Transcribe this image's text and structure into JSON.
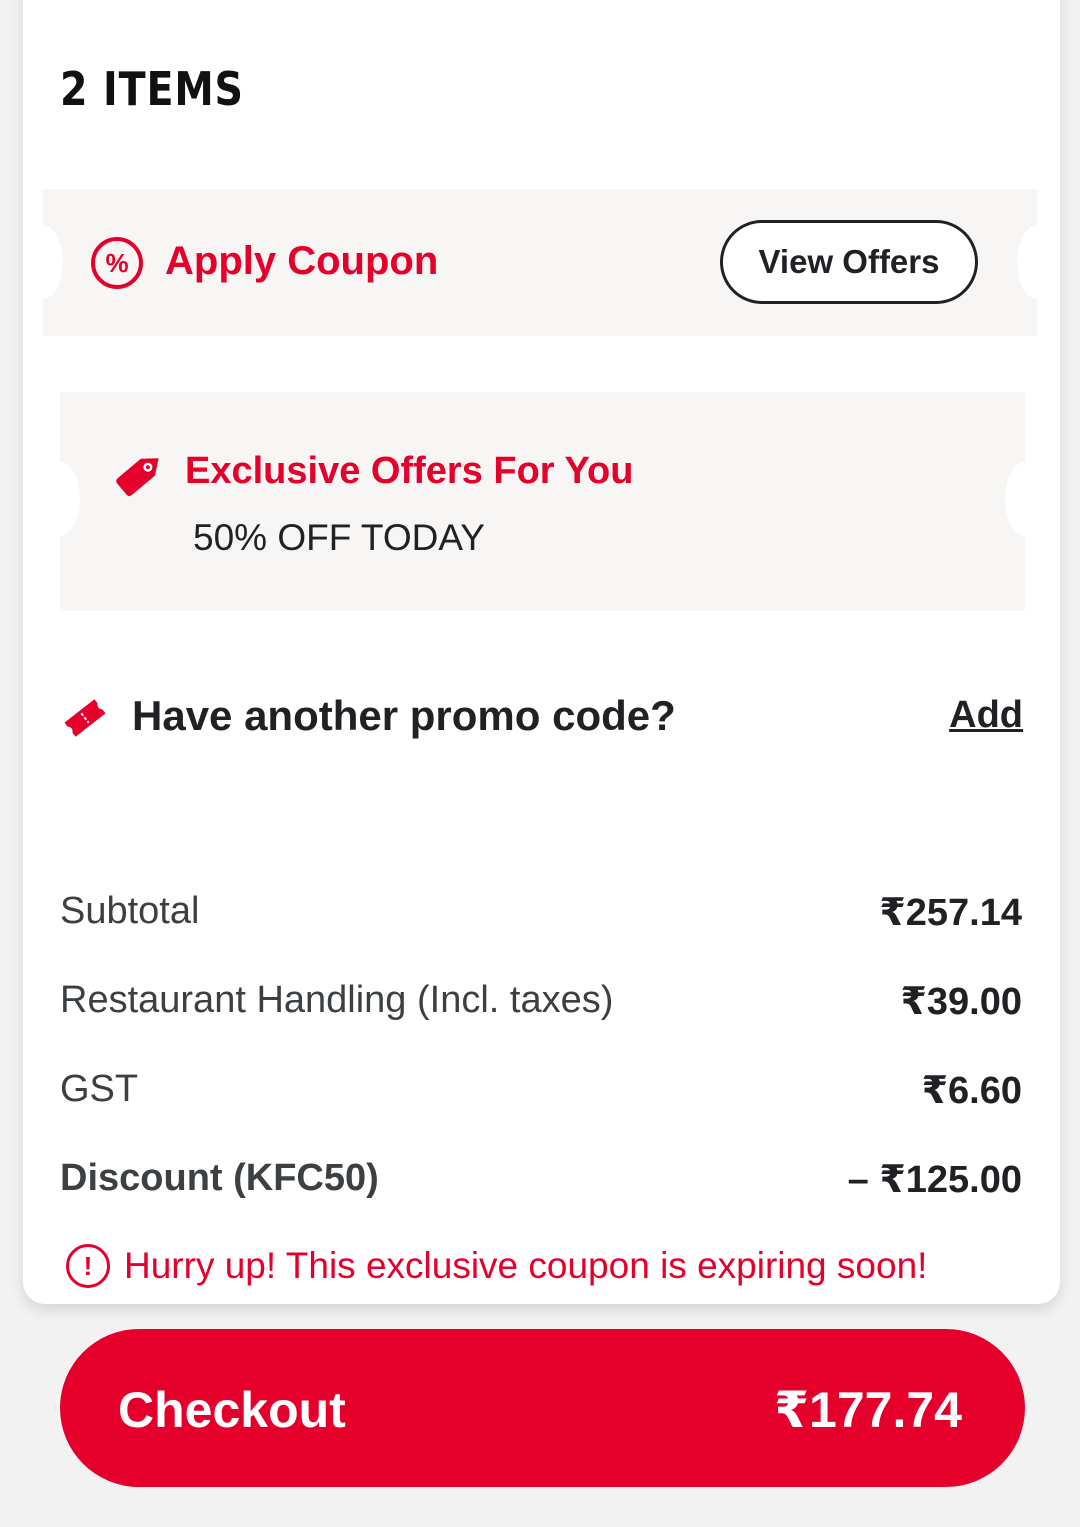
{
  "header": {
    "items_title": "2 ITEMS"
  },
  "coupon": {
    "percent_symbol": "%",
    "apply_label": "Apply Coupon",
    "view_offers_label": "View Offers"
  },
  "offers": {
    "title": "Exclusive Offers For You",
    "subtitle": "50% OFF TODAY"
  },
  "promo": {
    "label": "Have another promo code?",
    "add_label": "Add"
  },
  "summary": {
    "rows": [
      {
        "label": "Subtotal",
        "value": "₹257.14"
      },
      {
        "label": "Restaurant Handling (Incl. taxes)",
        "value": "₹39.00"
      },
      {
        "label": "GST",
        "value": "₹6.60"
      },
      {
        "label": "Discount (KFC50)",
        "value": "– ₹125.00"
      }
    ],
    "warning_icon": "!",
    "warning": "Hurry up! This exclusive coupon is expiring soon!"
  },
  "checkout": {
    "label": "Checkout",
    "total": "₹177.74"
  },
  "colors": {
    "brand_red": "#e4002b",
    "text_dark": "#202124",
    "panel_bg": "#f7f6f4"
  },
  "icons": [
    "percent-icon",
    "tag-icon",
    "ticket-icon",
    "alert-icon"
  ]
}
